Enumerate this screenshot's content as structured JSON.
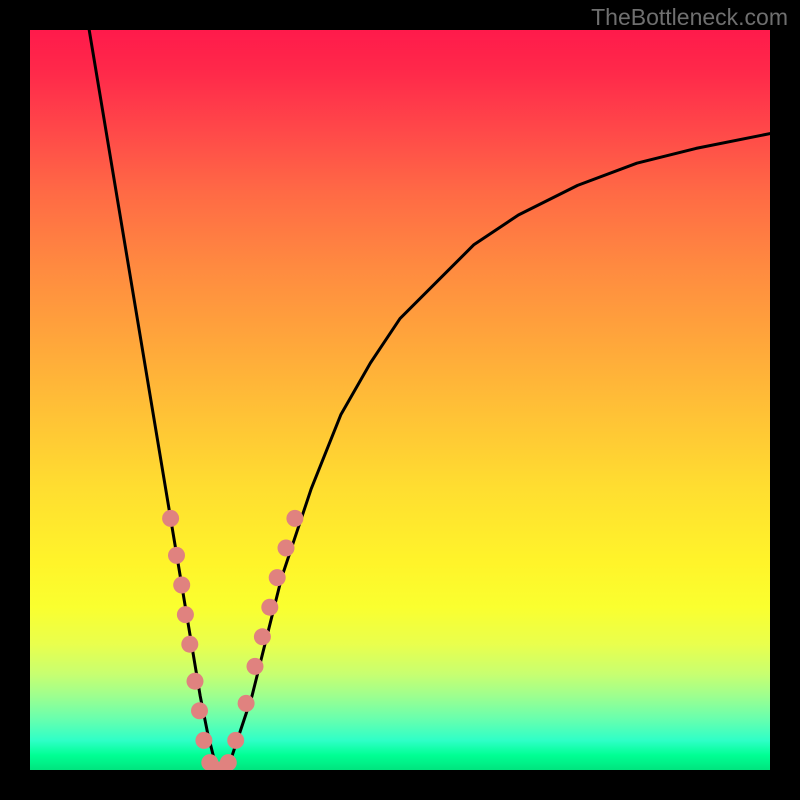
{
  "watermark": {
    "text": "TheBottleneck.com"
  },
  "chart_data": {
    "type": "line",
    "title": "",
    "xlabel": "",
    "ylabel": "",
    "xlim": [
      0,
      100
    ],
    "ylim": [
      0,
      100
    ],
    "series": [
      {
        "name": "bottleneck-curve",
        "x": [
          8,
          10,
          12,
          14,
          16,
          18,
          19,
          20,
          21,
          22,
          23,
          24,
          25,
          26,
          27,
          28,
          30,
          32,
          34,
          36,
          38,
          42,
          46,
          50,
          55,
          60,
          66,
          74,
          82,
          90,
          100
        ],
        "y": [
          100,
          88,
          76,
          64,
          52,
          40,
          34,
          28,
          22,
          16,
          10,
          5,
          1,
          0,
          1,
          4,
          10,
          18,
          26,
          32,
          38,
          48,
          55,
          61,
          66,
          71,
          75,
          79,
          82,
          84,
          86
        ]
      }
    ],
    "markers": {
      "name": "highlight-dots",
      "color": "#e0827f",
      "points": [
        {
          "x": 19.0,
          "y": 34
        },
        {
          "x": 19.8,
          "y": 29
        },
        {
          "x": 20.5,
          "y": 25
        },
        {
          "x": 21.0,
          "y": 21
        },
        {
          "x": 21.6,
          "y": 17
        },
        {
          "x": 22.3,
          "y": 12
        },
        {
          "x": 22.9,
          "y": 8
        },
        {
          "x": 23.5,
          "y": 4
        },
        {
          "x": 24.3,
          "y": 1
        },
        {
          "x": 25.5,
          "y": 0
        },
        {
          "x": 26.8,
          "y": 1
        },
        {
          "x": 27.8,
          "y": 4
        },
        {
          "x": 29.2,
          "y": 9
        },
        {
          "x": 30.4,
          "y": 14
        },
        {
          "x": 31.4,
          "y": 18
        },
        {
          "x": 32.4,
          "y": 22
        },
        {
          "x": 33.4,
          "y": 26
        },
        {
          "x": 34.6,
          "y": 30
        },
        {
          "x": 35.8,
          "y": 34
        }
      ]
    },
    "gradient_note": "Background vertical gradient red→orange→yellow→green represents bottleneck percentage; curve minimum touches green band."
  }
}
